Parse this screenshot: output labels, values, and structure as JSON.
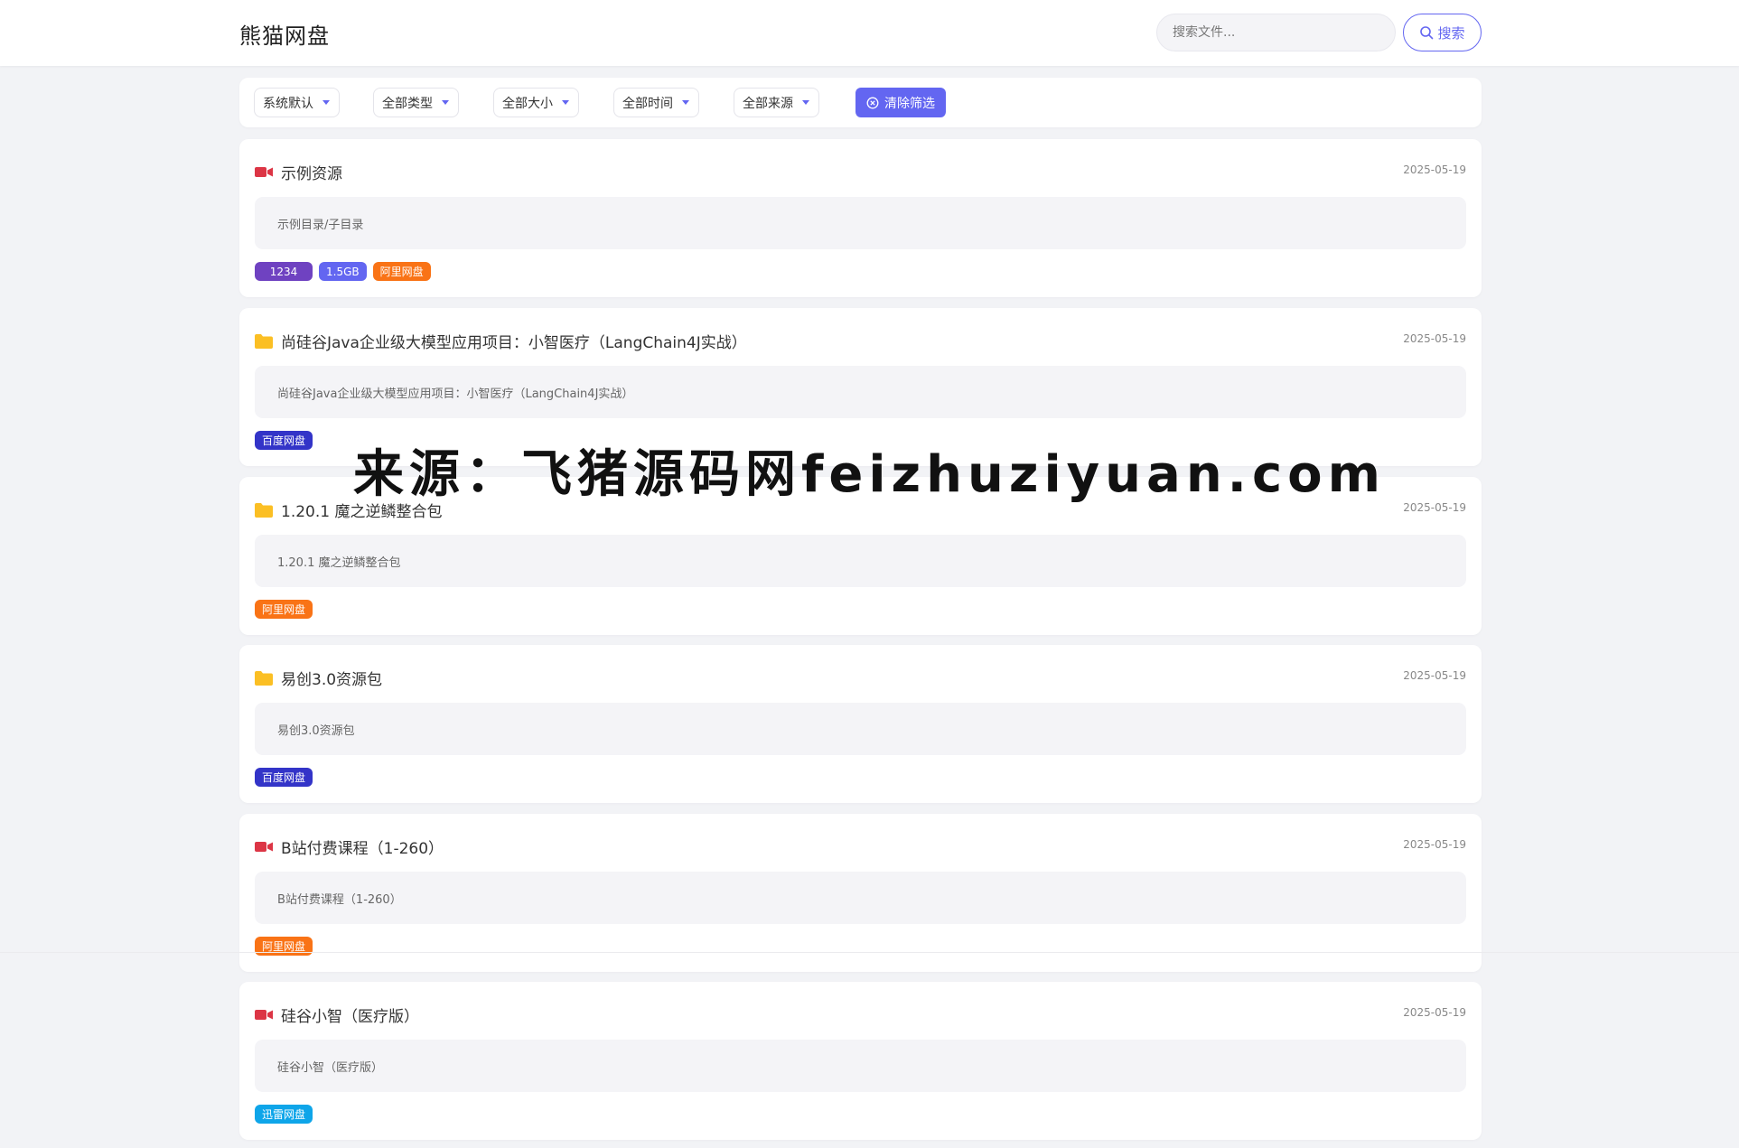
{
  "header": {
    "logo": "熊猫网盘",
    "search_placeholder": "搜索文件...",
    "search_button": "搜索"
  },
  "filters": {
    "sort": "系统默认",
    "type": "全部类型",
    "size": "全部大小",
    "time": "全部时间",
    "source": "全部来源",
    "clear": "清除筛选"
  },
  "colors": {
    "accent": "#6366f1",
    "video_icon": "#dc3545",
    "folder_icon": "#fbbf24"
  },
  "cards": [
    {
      "icon": "video-icon",
      "title": "示例资源",
      "date": "2025-05-19",
      "desc": "示例目录/子目录",
      "tags": [
        "1234",
        "1.5GB",
        "阿里网盘"
      ]
    },
    {
      "icon": "folder-icon",
      "title": "尚硅谷Java企业级大模型应用项目：小智医疗（LangChain4J实战）",
      "date": "2025-05-19",
      "desc": "尚硅谷Java企业级大模型应用项目：小智医疗（LangChain4J实战）",
      "tags": [
        "百度网盘"
      ]
    },
    {
      "icon": "folder-icon",
      "title": "1.20.1 魔之逆鳞整合包",
      "date": "2025-05-19",
      "desc": "1.20.1 魔之逆鳞整合包",
      "tags": [
        "阿里网盘"
      ]
    },
    {
      "icon": "folder-icon",
      "title": "易创3.0资源包",
      "date": "2025-05-19",
      "desc": "易创3.0资源包",
      "tags": [
        "百度网盘"
      ]
    },
    {
      "icon": "video-icon",
      "title": "B站付费课程（1-260）",
      "date": "2025-05-19",
      "desc": "B站付费课程（1-260）",
      "tags": [
        "阿里网盘"
      ]
    },
    {
      "icon": "video-icon",
      "title": "硅谷小智（医疗版）",
      "date": "2025-05-19",
      "desc": "硅谷小智（医疗版）",
      "tags": [
        "迅雷网盘"
      ]
    }
  ],
  "watermark": "来源：飞猪源码网feizhuziyuan.com"
}
